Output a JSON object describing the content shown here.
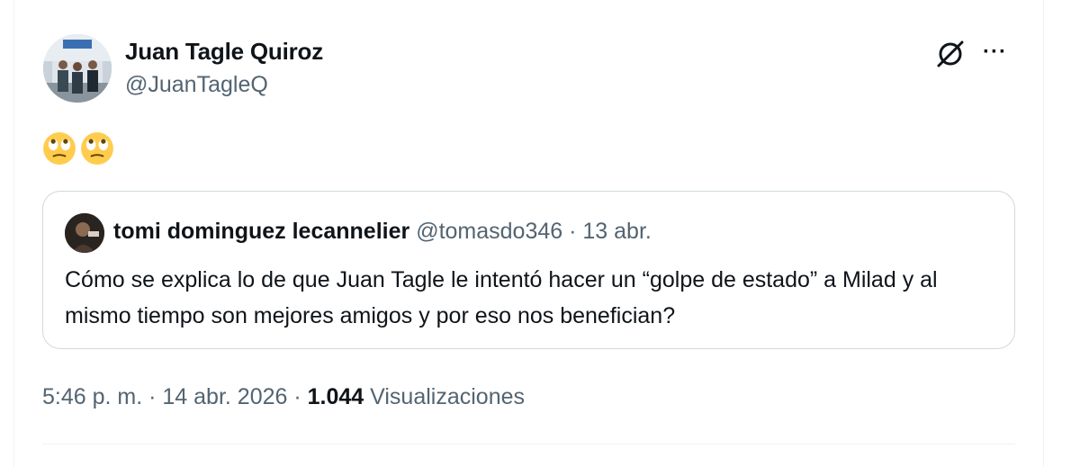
{
  "tweet": {
    "author_name": "Juan Tagle Quiroz",
    "author_handle": "@JuanTagleQ",
    "emoji_count": 2,
    "emoji_icon": "face-with-rolling-eyes",
    "timestamp": "5:46 p. m. · 14 abr. 2026 · ",
    "views_count": "1.044",
    "views_label": " Visualizaciones"
  },
  "quote": {
    "author_name": "tomi dominguez lecannelier",
    "author_handle": "@tomasdo346",
    "separator": " · ",
    "date": "13 abr.",
    "text": "Cómo se explica lo de que Juan Tagle le intentó hacer un “golpe de estado” a Milad y al mismo tiempo son mejores amigos y por eso nos benefician?"
  },
  "icons": {
    "grok": "grok-icon",
    "more": "more-options-icon"
  },
  "colors": {
    "text_primary": "#0f1419",
    "text_secondary": "#536471",
    "border": "#cfd9de",
    "emoji_yellow": "#ffcc4d"
  }
}
